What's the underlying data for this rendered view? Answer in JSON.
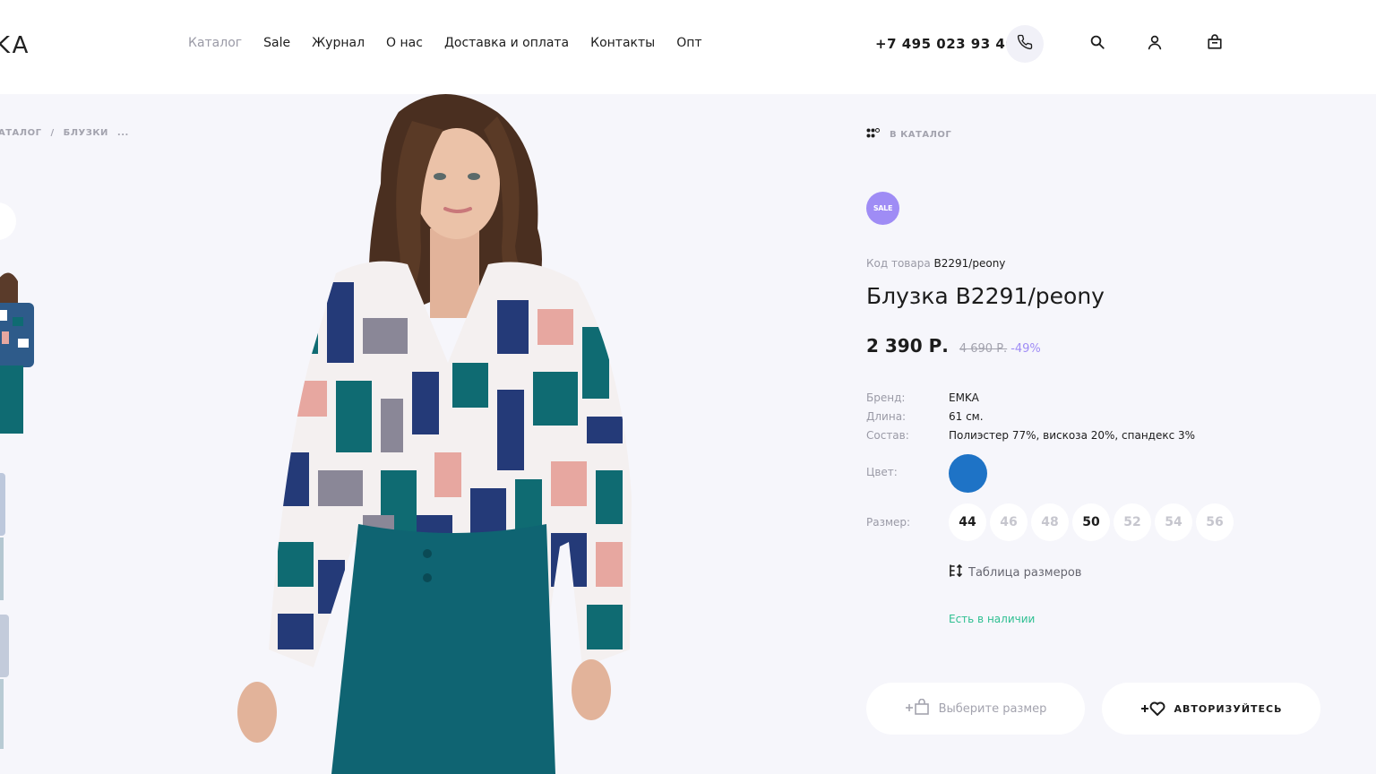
{
  "header": {
    "logo": "KA",
    "nav": [
      {
        "label": "Каталог",
        "muted": true
      },
      {
        "label": "Sale",
        "muted": false
      },
      {
        "label": "Журнал",
        "muted": false
      },
      {
        "label": "О нас",
        "muted": false
      },
      {
        "label": "Доставка и оплата",
        "muted": false
      },
      {
        "label": "Контакты",
        "muted": false
      },
      {
        "label": "Опт",
        "muted": false
      }
    ],
    "phone": "+7 495 023 93 40",
    "icons": [
      "phone-icon",
      "search-icon",
      "user-icon",
      "cart-icon"
    ]
  },
  "breadcrumb": {
    "items": [
      "АТАЛОГ",
      "/",
      "БЛУЗКИ",
      "..."
    ]
  },
  "product": {
    "to_catalog": "В КАТАЛОГ",
    "badge": "SALE",
    "code_label": "Код товара",
    "code_value": "B2291/peony",
    "title": "Блузка B2291/peony",
    "price": "2 390 Р.",
    "old_price": "4 690 Р.",
    "discount": "-49%",
    "props": [
      {
        "key": "Бренд:",
        "value": "EMKA"
      },
      {
        "key": "Длина:",
        "value": "61 см."
      },
      {
        "key": "Состав:",
        "value": "Полиэстер 77%, вискоза 20%, спандекс 3%"
      }
    ],
    "color_label": "Цвет:",
    "color_value": "#1e73c6",
    "size_label": "Размер:",
    "sizes": [
      {
        "label": "44",
        "available": true
      },
      {
        "label": "46",
        "available": false
      },
      {
        "label": "48",
        "available": false
      },
      {
        "label": "50",
        "available": true
      },
      {
        "label": "52",
        "available": false
      },
      {
        "label": "54",
        "available": false
      },
      {
        "label": "56",
        "available": false
      }
    ],
    "size_table": "Таблица размеров",
    "stock": "Есть в наличии",
    "btn_select": "Выберите размер",
    "btn_auth": "АВТОРИЗУЙТЕСЬ"
  },
  "colors": {
    "accent": "#9f8cf5",
    "stock": "#2ebf91",
    "swatch": "#1e73c6",
    "blouse_teal": "#0f6b72",
    "blouse_navy": "#243a78"
  }
}
